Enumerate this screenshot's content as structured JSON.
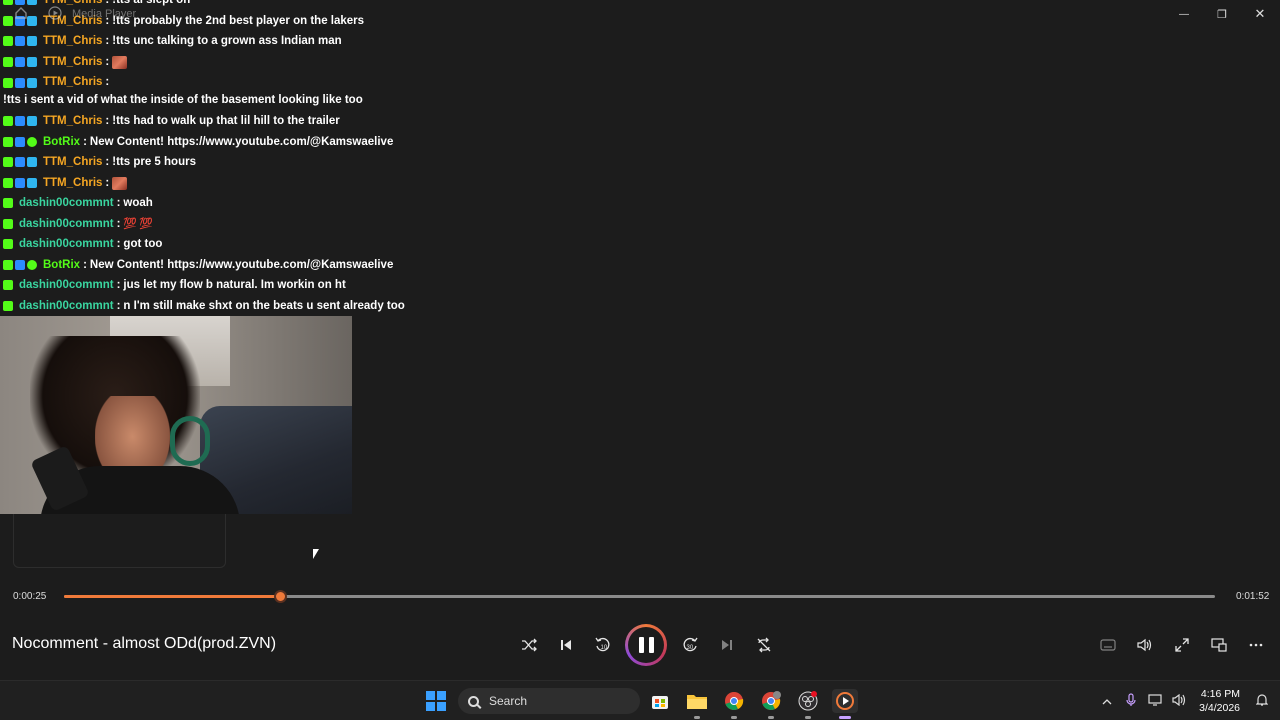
{
  "window": {
    "app_name": "Media Player",
    "minimize": "—",
    "restore": "❐",
    "close": "✕"
  },
  "chat": {
    "messages": [
      {
        "user": "TTM_Chris",
        "color": "orange",
        "badges": [
          "green",
          "blue",
          "cyan"
        ],
        "text": "!tts al slept on"
      },
      {
        "user": "TTM_Chris",
        "color": "orange",
        "badges": [
          "green",
          "blue",
          "cyan"
        ],
        "text": "!tts probably the 2nd best player on the lakers"
      },
      {
        "user": "TTM_Chris",
        "color": "orange",
        "badges": [
          "green",
          "blue",
          "cyan"
        ],
        "text": "!tts unc talking to a grown ass Indian man"
      },
      {
        "user": "TTM_Chris",
        "color": "orange",
        "badges": [
          "green",
          "blue",
          "cyan"
        ],
        "text": "",
        "emote": true
      },
      {
        "user": "TTM_Chris",
        "color": "orange",
        "badges": [
          "green",
          "blue",
          "cyan"
        ],
        "text": "!tts i sent a vid of what the inside of the basement looking like too",
        "wrap": true
      },
      {
        "user": "TTM_Chris",
        "color": "orange",
        "badges": [
          "green",
          "blue",
          "cyan"
        ],
        "text": "!tts had to walk up that lil hill to the trailer"
      },
      {
        "user": "BotRix",
        "color": "lime",
        "badges": [
          "green",
          "blue",
          "verify"
        ],
        "text": "New Content! https://www.youtube.com/@Kamswaelive"
      },
      {
        "user": "TTM_Chris",
        "color": "orange",
        "badges": [
          "green",
          "blue",
          "cyan"
        ],
        "text": "!tts pre 5 hours"
      },
      {
        "user": "TTM_Chris",
        "color": "orange",
        "badges": [
          "green",
          "blue",
          "cyan"
        ],
        "text": "",
        "emote": true
      },
      {
        "user": "dashin00commnt",
        "color": "teal",
        "badges": [
          "green"
        ],
        "text": "woah"
      },
      {
        "user": "dashin00commnt",
        "color": "teal",
        "badges": [
          "green"
        ],
        "text": "",
        "hearts": "💯💯"
      },
      {
        "user": "dashin00commnt",
        "color": "teal",
        "badges": [
          "green"
        ],
        "text": "got too"
      },
      {
        "user": "BotRix",
        "color": "lime",
        "badges": [
          "green",
          "blue",
          "verify"
        ],
        "text": "New Content! https://www.youtube.com/@Kamswaelive"
      },
      {
        "user": "dashin00commnt",
        "color": "teal",
        "badges": [
          "green"
        ],
        "text": "jus let my flow b natural. Im workin on ht"
      },
      {
        "user": "dashin00commnt",
        "color": "teal",
        "badges": [
          "green"
        ],
        "text": "n I'm still make shxt on the beats u sent already too"
      }
    ]
  },
  "player": {
    "current_time": "0:00:25",
    "total_time": "0:01:52",
    "progress": 0.1875,
    "track_title": "Nocomment - almost ODd(prod.ZVN)",
    "accent": "#f07a3a"
  },
  "taskbar": {
    "search_placeholder": "Search",
    "time": "4:16 PM",
    "date": "3/4/2026"
  }
}
